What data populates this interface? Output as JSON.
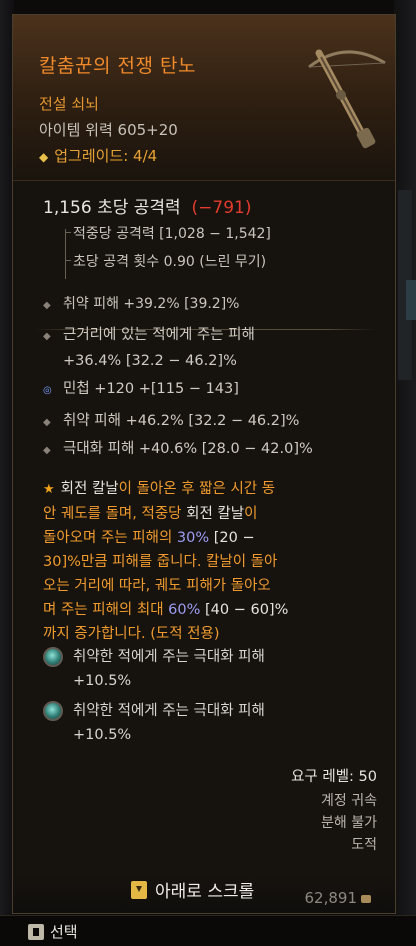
{
  "item": {
    "name": "칼춤꾼의 전쟁 탄노",
    "rarity_type": "전설 쇠뇌",
    "item_power": "아이템 위력 605+20",
    "upgrade": "업그레이드: 4/4"
  },
  "stats": {
    "dps_value": "1,156 초당 공격력",
    "dps_delta": "(−791)",
    "damage_per_hit": "적중당 공격력 [1,028 − 1,542]",
    "attack_speed": "초당 공격 횟수 0.90 (느린 무기)",
    "implicit": "취약 피해 +39.2% [39.2]%"
  },
  "affixes": [
    {
      "line1": "근거리에 있는 적에게 주는 피해",
      "line2": "+36.4% [32.2 − 46.2]%"
    },
    {
      "line1": "민첩 +120 +[115 − 143]",
      "line2": ""
    },
    {
      "line1": "취약 피해 +46.2% [32.2 − 46.2]%",
      "line2": ""
    },
    {
      "line1": "극대화 피해 +40.6% [28.0 − 42.0]%",
      "line2": ""
    }
  ],
  "legendary": {
    "l1a": "회전 칼날",
    "l1b": "이 돌아온 후 짧은 시간 동",
    "l2a": "안 궤도를 돌며, 적중당 ",
    "l2b": "회전 칼날",
    "l2c": "이",
    "l3a": "돌아오며 주는 피해의 ",
    "l3b": "30%",
    "l3c": " [20 −",
    "l4": "30]%만큼 피해를 줍니다. 칼날이 돌아",
    "l5": "오는 거리에 따라, 궤도 피해가 돌아오",
    "l6a": "며 주는 피해의 최대 ",
    "l6b": "60%",
    "l6c": " [40 − 60]%",
    "l7": "까지 증가합니다. (도적 전용)"
  },
  "sockets": [
    {
      "line1": "취약한 적에게 주는 극대화 피해",
      "line2": "+10.5%"
    },
    {
      "line1": "취약한 적에게 주는 극대화 피해",
      "line2": "+10.5%"
    }
  ],
  "requirements": {
    "level": "요구 레벨: 50",
    "bound": "계정 귀속",
    "salvage": "분해 불가",
    "class": "도적"
  },
  "ui": {
    "scroll_prompt": "아래로 스크롤",
    "price": "62,891",
    "select_label": "선택"
  }
}
